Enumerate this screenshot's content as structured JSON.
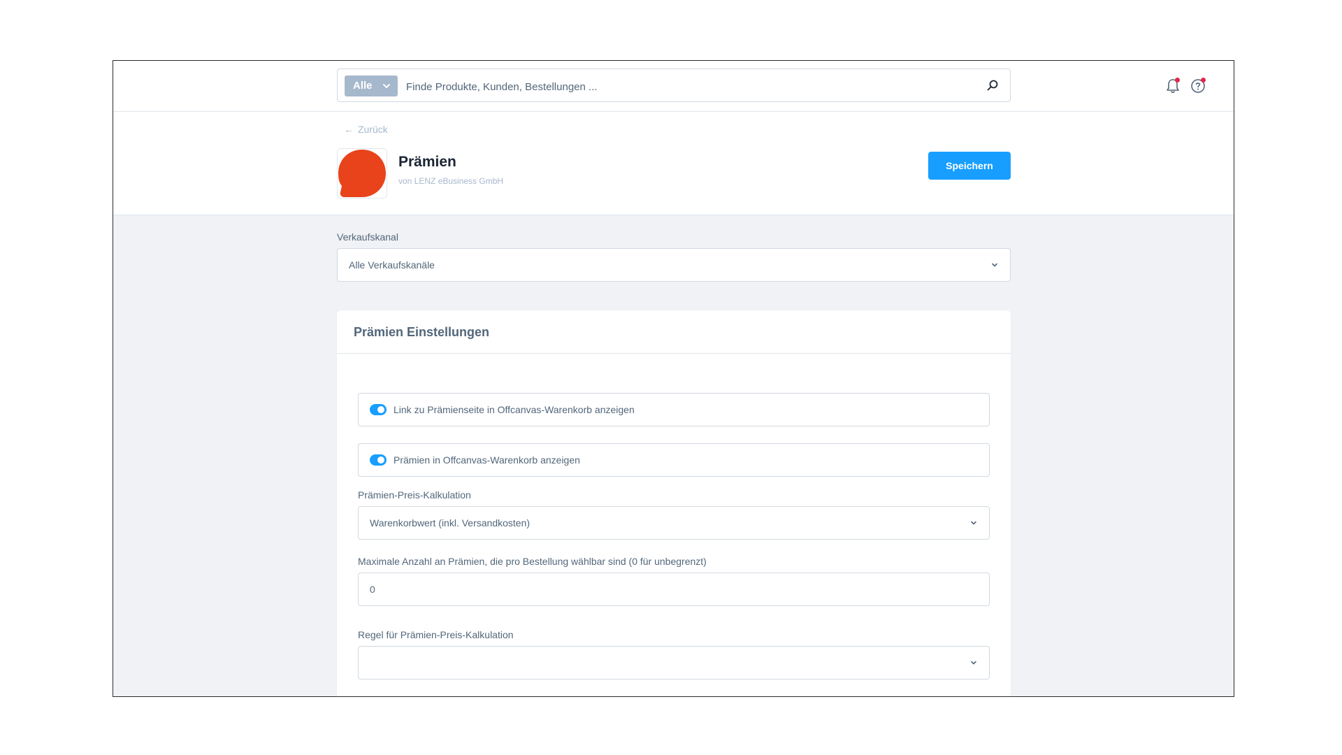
{
  "search": {
    "type_label": "Alle",
    "placeholder": "Finde Produkte, Kunden, Bestellungen ..."
  },
  "header": {
    "back_label": "Zurück",
    "title": "Prämien",
    "vendor": "von LENZ eBusiness GmbH",
    "save_label": "Speichern",
    "logo_color": "#e8431a"
  },
  "sales_channel": {
    "label": "Verkaufskanal",
    "value": "Alle Verkaufskanäle"
  },
  "settings": {
    "title": "Prämien Einstellungen",
    "switches": [
      {
        "label": "Link zu Prämienseite in Offcanvas-Warenkorb anzeigen",
        "checked": true
      },
      {
        "label": "Prämien in Offcanvas-Warenkorb anzeigen",
        "checked": true
      }
    ],
    "price_calc": {
      "label": "Prämien-Preis-Kalkulation",
      "value": "Warenkorbwert (inkl. Versandkosten)"
    },
    "max_count": {
      "label": "Maximale Anzahl an Prämien, die pro Bestellung wählbar sind (0 für unbegrenzt)",
      "value": "0"
    },
    "rule": {
      "label": "Regel für Prämien-Preis-Kalkulation",
      "value": ""
    }
  },
  "colors": {
    "primary": "#189eff",
    "notification_dot": "#de294c",
    "text": "#52667a",
    "heading": "#1b2533"
  }
}
